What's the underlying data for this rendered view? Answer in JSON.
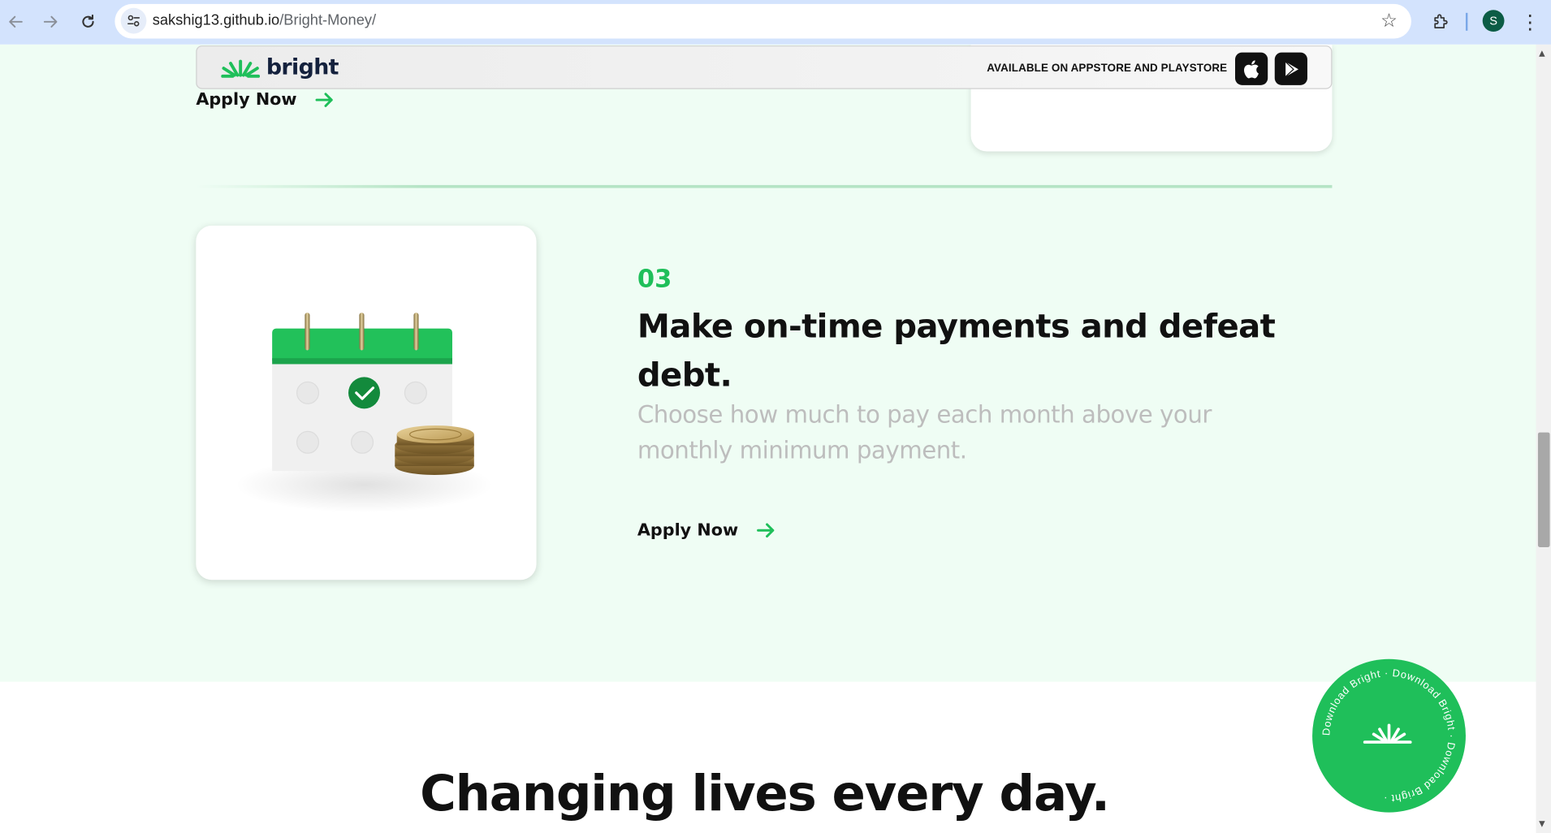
{
  "browser": {
    "url_host": "sakshig13.github.io",
    "url_path": "/Bright-Money/",
    "profile_initial": "S"
  },
  "header": {
    "logo_text": "bright",
    "availability_text": "AVAILABLE ON APPSTORE AND PLAYSTORE",
    "appstore_icon": "apple-icon",
    "playstore_icon": "play-store-icon"
  },
  "previous_section": {
    "apply_label": "Apply Now"
  },
  "step": {
    "number": "03",
    "title": "Make on-time payments and defeat debt.",
    "description": "Choose how much to pay each month above your monthly minimum payment.",
    "apply_label": "Apply Now",
    "illustration": "calendar-with-coins-icon"
  },
  "next_section": {
    "title": "Changing lives every day."
  },
  "download_badge": {
    "ring_text": "Download Bright · Download Bright · Download Bright ·"
  },
  "colors": {
    "brand_green": "#1fbf5a",
    "mint_background": "#effdf4",
    "heading": "#111111",
    "muted_text": "#bdbdbd"
  }
}
